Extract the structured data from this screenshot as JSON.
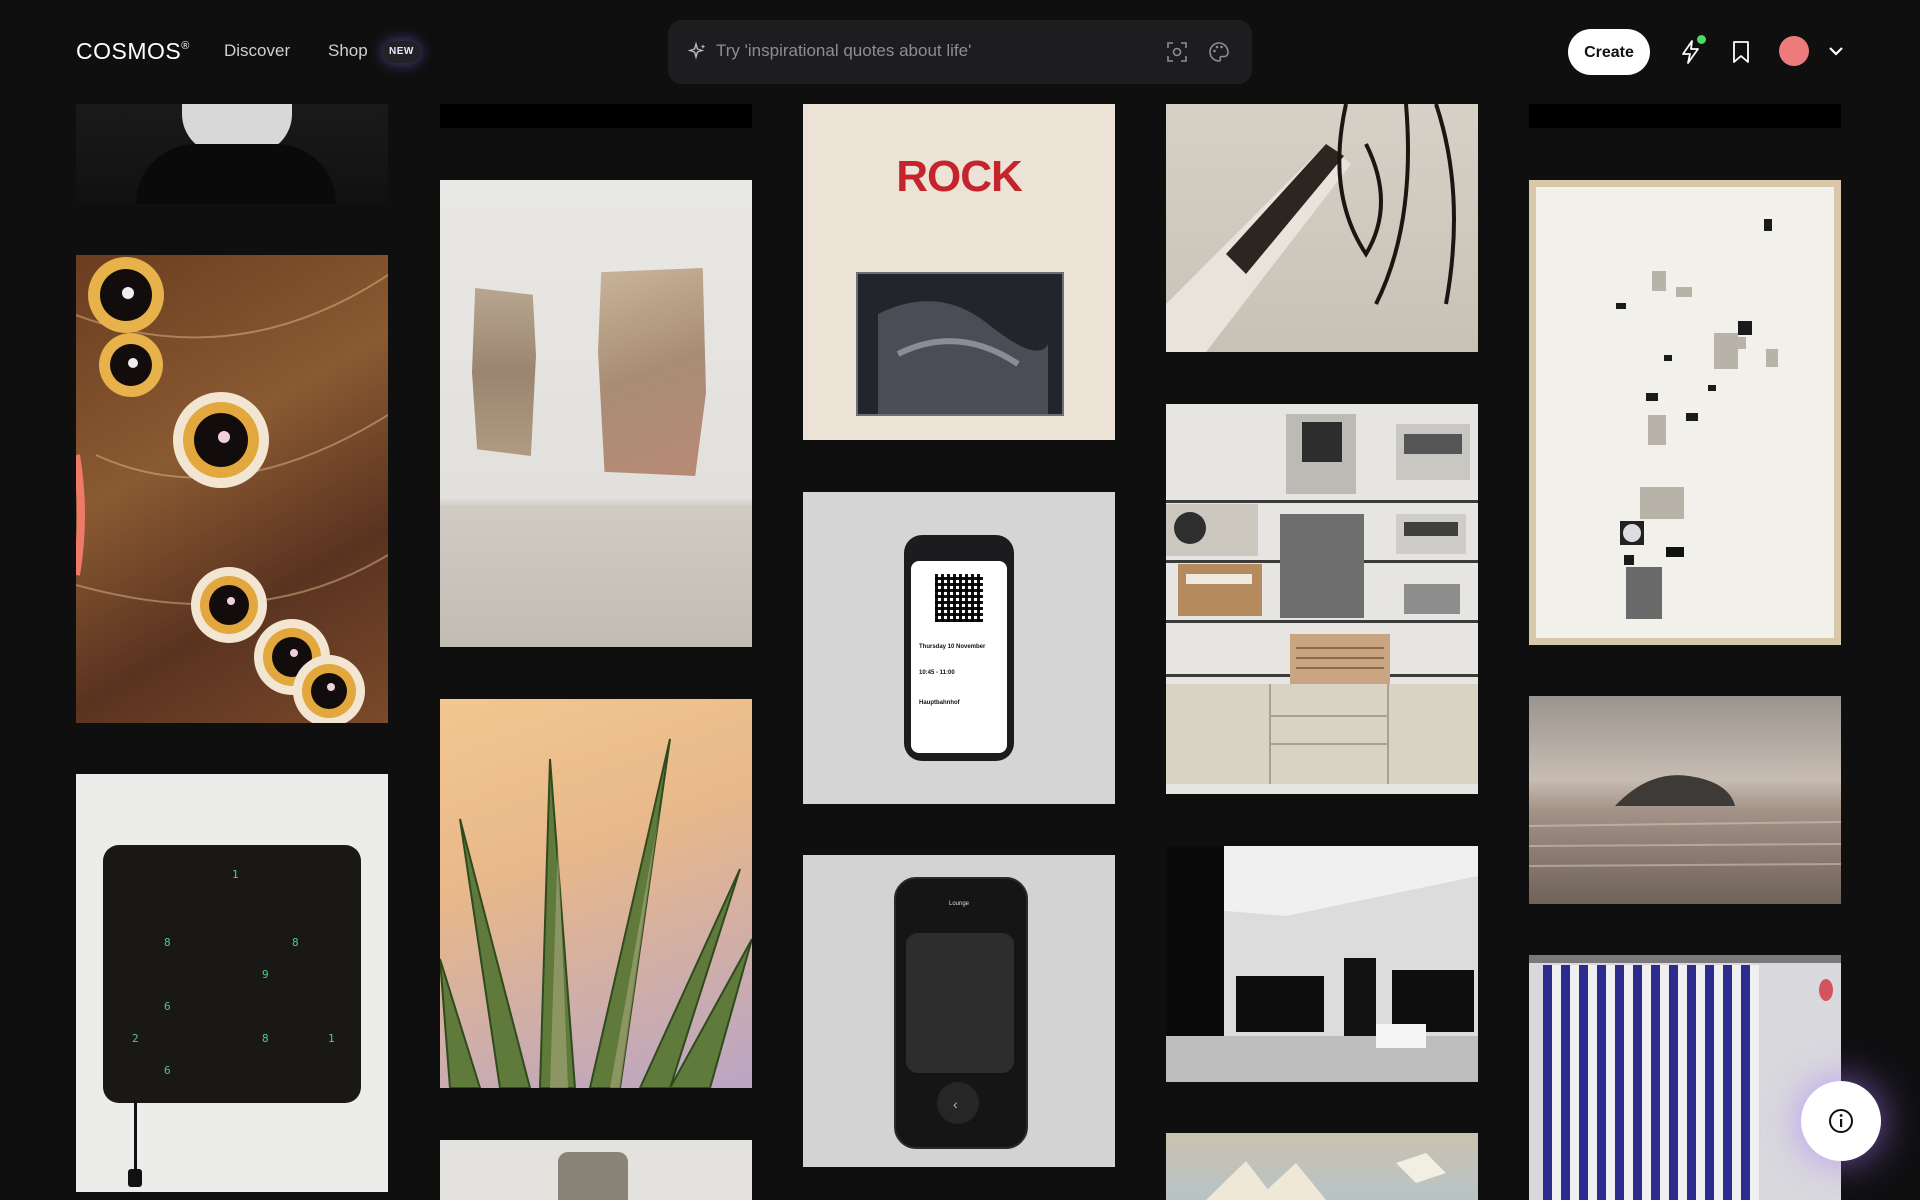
{
  "header": {
    "logo": "COSMOS",
    "logo_mark": "®",
    "nav": [
      {
        "label": "Discover"
      },
      {
        "label": "Shop"
      }
    ],
    "shop_badge": "NEW",
    "search_placeholder": "Try 'inspirational quotes about life'",
    "create_label": "Create",
    "avatar_color": "#ee7b7b"
  },
  "feed": {
    "poster_text": "ROCK",
    "ticket_date": "Thursday 10 November",
    "ticket_time": "10:45 - 11:00",
    "ticket_location": "Hauptbahnhof",
    "remote_title": "Lounge",
    "clock_digits": [
      "1",
      "8",
      "8",
      "9",
      "6",
      "2",
      "8",
      "1",
      "6"
    ]
  },
  "colors": {
    "background": "#0f0f10",
    "search_bg": "#1d1d20",
    "accent_glow": "#8c78ff"
  }
}
